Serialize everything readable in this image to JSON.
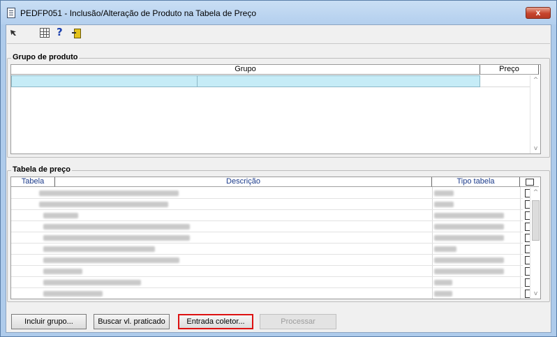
{
  "window": {
    "title": "PEDFP051 - Inclusão/Alteração de Produto na Tabela de Preço",
    "close_label": "x"
  },
  "toolbar": {
    "icons": [
      "pointer-icon",
      "grid-icon",
      "help-icon",
      "exit-door-icon"
    ],
    "help_glyph": "?"
  },
  "grupo_produto": {
    "label": "Grupo de produto",
    "columns": [
      "Grupo",
      "Preço"
    ],
    "scroll_up": "^",
    "scroll_down": "v"
  },
  "tabela_preco": {
    "label": "Tabela de preço",
    "columns": [
      "Tabela",
      "Descrição",
      "Tipo tabela"
    ],
    "rows": 10,
    "scroll_up": "^",
    "scroll_down": "v"
  },
  "buttons": {
    "incluir_grupo": "Incluir grupo...",
    "buscar_vl": "Buscar vl. praticado",
    "entrada_coletor": "Entrada coletor...",
    "processar": "Processar"
  }
}
